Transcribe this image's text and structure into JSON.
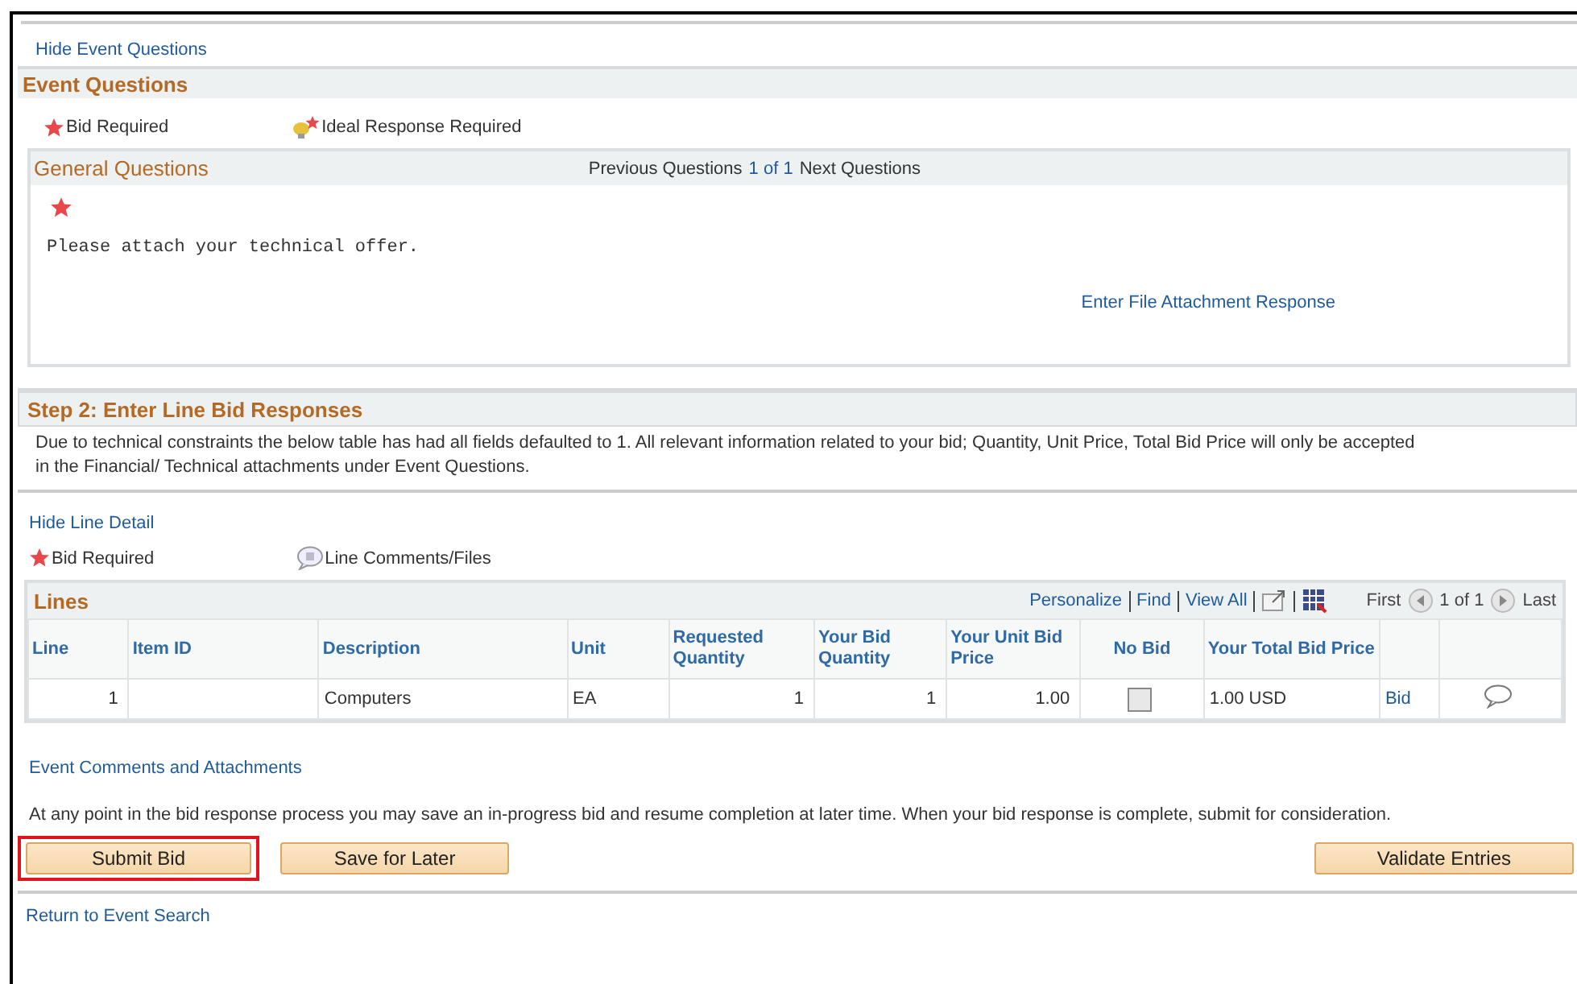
{
  "hide_questions_link": "Hide Event Questions",
  "event_questions": {
    "title": "Event Questions",
    "legend": [
      {
        "kind": "star",
        "label": "Bid Required"
      },
      {
        "kind": "bulb",
        "label": "Ideal Response Required"
      }
    ],
    "general": {
      "title": "General Questions",
      "previous": "Previous Questions",
      "count": "1 of 1",
      "next": "Next Questions",
      "required": true,
      "question": "Please attach your technical offer.",
      "response_link": "Enter File Attachment Response"
    }
  },
  "step2": {
    "title": "Step 2: Enter Line Bid Responses",
    "note": "Due to technical constraints the below table has had all fields defaulted to 1. All relevant information related to your bid; Quantity, Unit Price, Total Bid Price will only be accepted in the Financial/ Technical attachments under Event Questions."
  },
  "hide_line_link": "Hide Line Detail",
  "line_legend": [
    {
      "kind": "star",
      "label": "Bid Required"
    },
    {
      "kind": "comment",
      "label": "Line Comments/Files"
    }
  ],
  "lines": {
    "title": "Lines",
    "toolbar": [
      "Personalize",
      "Find",
      "View All"
    ],
    "first": "First",
    "count": "1 of 1",
    "last": "Last",
    "columns": [
      "Line",
      "Item ID",
      "Description",
      "Unit",
      "Requested Quantity",
      "Your Bid Quantity",
      "Your Unit Bid Price",
      "No Bid",
      "Your Total Bid Price"
    ],
    "rows": [
      {
        "cells": [
          {
            "kind": "number",
            "text": "1"
          },
          {
            "kind": "blank"
          },
          {
            "kind": "text",
            "text": "Computers"
          },
          {
            "kind": "text",
            "text": "EA"
          },
          {
            "kind": "number",
            "text": "1"
          },
          {
            "kind": "number",
            "text": "1"
          },
          {
            "kind": "number",
            "text": "1.00"
          },
          {
            "kind": "checkbox",
            "checked": false
          },
          {
            "kind": "text",
            "text": "1.00 USD"
          },
          {
            "kind": "link",
            "text": "Bid"
          },
          {
            "kind": "comment"
          }
        ]
      }
    ]
  },
  "comments_link": "Event Comments and Attachments",
  "info": "At any point in the bid response process you may save an in-progress bid and resume completion at later time. When your bid response is complete, submit for consideration.",
  "buttons": [
    {
      "label": "Submit Bid",
      "highlighted": true
    },
    {
      "label": "Save for Later",
      "highlighted": false
    },
    {
      "label": "Validate Entries",
      "highlighted": false
    }
  ],
  "return_link": "Return to Event Search"
}
